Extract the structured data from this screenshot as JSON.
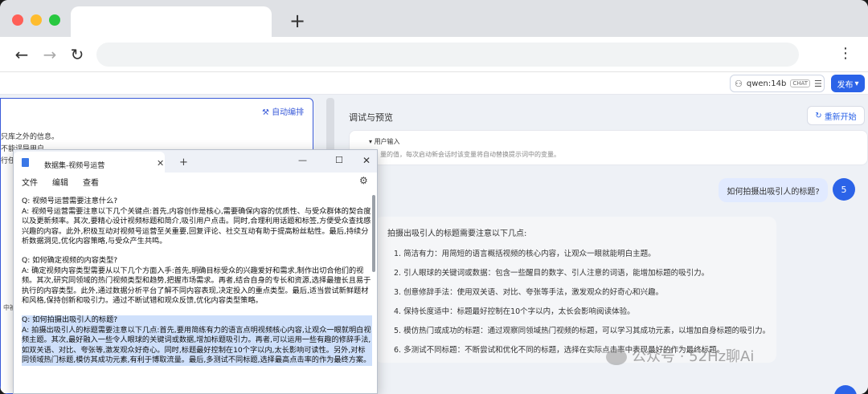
{
  "app": {
    "model_name": "qwen:14b",
    "model_badge": "CHAT",
    "publish_label": "发布",
    "auto_arrange": "自动编排",
    "left_snippets": [
      "只库之外的信息。",
      "不能误导用户。",
      "行任"
    ],
    "left_mid": "中被"
  },
  "debug": {
    "title": "调试与预览",
    "restart_label": "重新开始",
    "user_input_title": "用户输入",
    "user_input_desc": "量的值，每次启动新会话时该变量将自动替换提示词中的变量。"
  },
  "chat": {
    "question": "如何拍摄出吸引人的标题?",
    "question_avatar": "5",
    "answer_intro": "拍摄出吸引人的标题需要注意以下几点:",
    "answer_items": [
      "1. 简洁有力：用简短的语言概括视频的核心内容，让观众一眼就能明白主题。",
      "2. 引人眼球的关键词或数据：包含一些醒目的数字、引人注意的词语，能增加标题的吸引力。",
      "3. 创意修辞手法：使用双关语、对比、夸张等手法，激发观众的好奇心和兴趣。",
      "4. 保持长度适中：标题最好控制在10个字以内，太长会影响阅读体验。",
      "5. 模仿热门或成功的标题：通过观察同领域热门视频的标题，可以学习其成功元素，以增加自身标题的吸引力。",
      "6. 多测试不同标题：不断尝试和优化不同的标题，选择在实际点击率中表现最好的作为最终标题。"
    ]
  },
  "watermark": "公众号 · 52Hz聊Ai",
  "notepad": {
    "title": "数据集-视频号运营",
    "menu": [
      "文件",
      "编辑",
      "查看"
    ],
    "blocks": [
      "Q: 视频号运营需要注意什么?\nA: 视频号运营需要注意以下几个关键点:首先,内容创作是核心,需要确保内容的优质性、与受众群体的契合度以及更新频率。其次,要精心设计视频标题和简介,吸引用户点击。同时,合理利用话题和标签,方便受众查找感兴趣的内容。此外,积极互动对视频号运营至关重要,回复评论、社交互动有助于提高粉丝粘性。最后,持续分析数据洞见,优化内容策略,与受众产生共鸣。",
      "Q: 如何确定视频的内容类型?\nA: 确定视频内容类型需要从以下几个方面入手:首先,明确目标受众的兴趣爱好和需求,制作出切合他们的视频。其次,研究同领域的热门视频类型和趋势,把握市场需求。再者,结合自身的专长和资源,选择最擅长且易于执行的内容类型。此外,通过数据分析平台了解不同内容表现,决定投入的重点类型。最后,适当尝试新鲜题材和风格,保持创新和吸引力。通过不断试错和观众反馈,优化内容类型策略。",
      "Q: 如何拍摄出吸引人的标题?\nA: 拍摄出吸引人的标题需要注意以下几点:首先,要用简练有力的语言点明视频核心内容,让观众一眼就明白视频主题。其次,最好融入一些令人眼球的关键词或数据,增加标题吸引力。再者,可以运用一些有趣的修辞手法,如双关语、对比、夸张等,激发观众好奇心。同时,标题最好控制在10个字以内,太长影响可读性。另外,对标同领域热门标题,模仿其成功元素,有利于博取流量。最后,多测试不同标题,选择最高点击率的作为最终方案。"
    ]
  }
}
